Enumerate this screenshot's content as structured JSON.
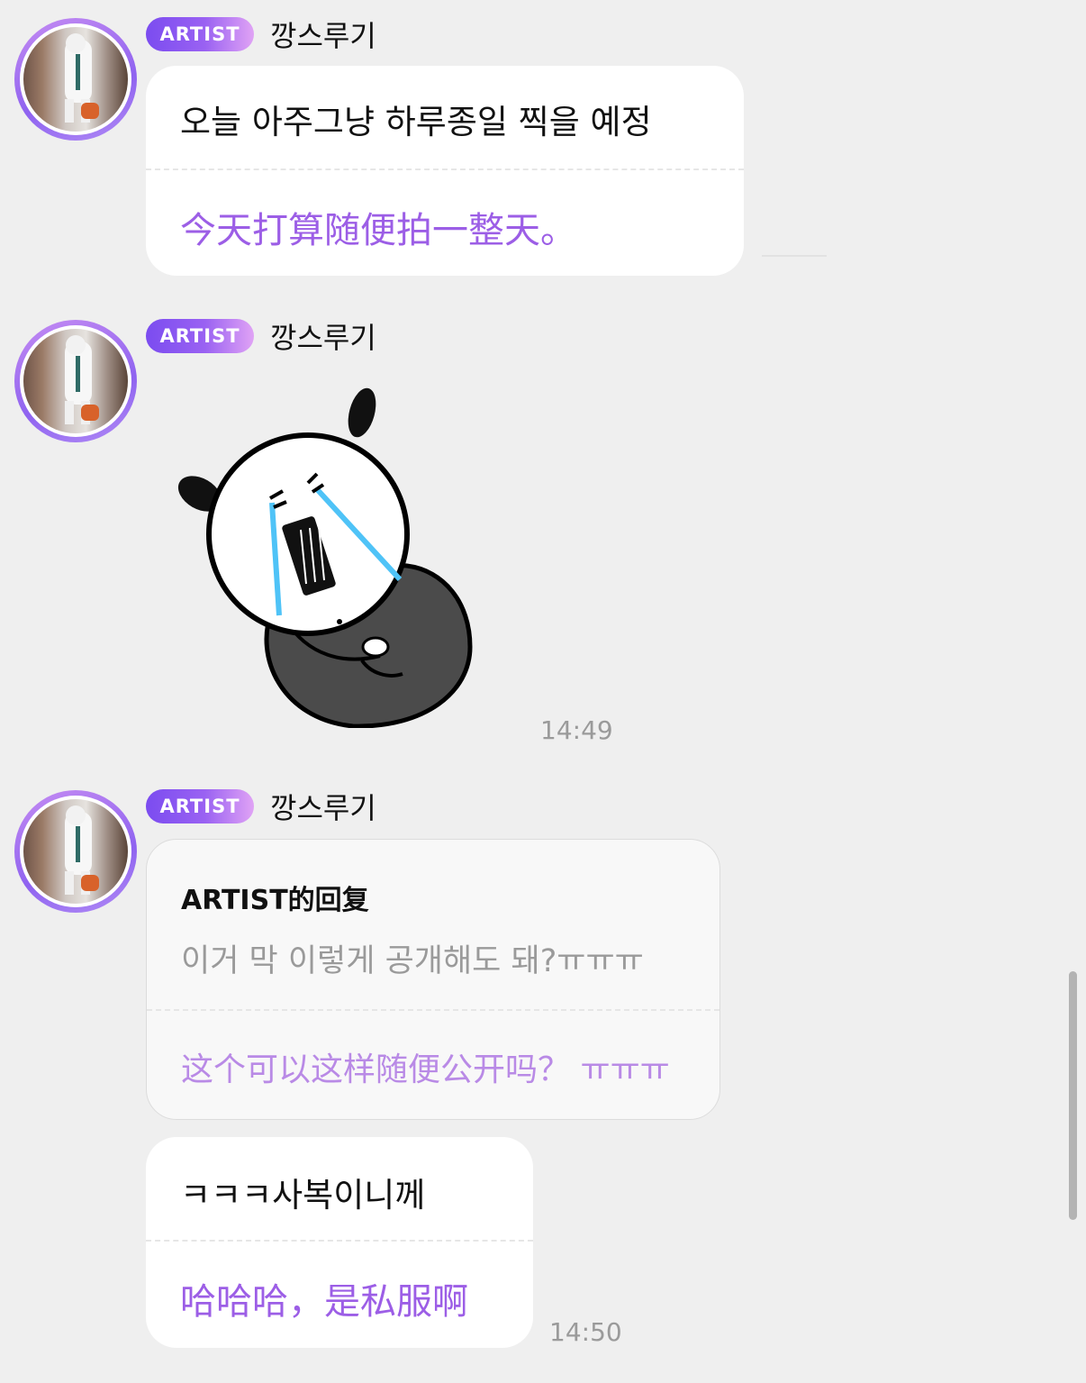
{
  "messages": [
    {
      "badge": "ARTIST",
      "sender": "깡스루기",
      "text_ko": "오늘 아주그냥 하루종일 찍을 예정",
      "text_zh": "今天打算随便拍一整天。"
    },
    {
      "badge": "ARTIST",
      "sender": "깡스루기",
      "sticker": "crying-bear-sticker",
      "time": "14:49"
    },
    {
      "badge": "ARTIST",
      "sender": "깡스루기",
      "reply": {
        "title": "ARTIST的回复",
        "text_ko": "이거 막 이렇게 공개해도 돼?ㅠㅠㅠ",
        "text_zh": "这个可以这样随便公开吗？ ㅠㅠㅠ"
      },
      "text_ko": "ㅋㅋㅋ사복이니께",
      "text_zh": "哈哈哈，是私服啊",
      "time": "14:50"
    }
  ],
  "colors": {
    "background": "#efefef",
    "translation": "#9c5ee6",
    "badge_gradient_start": "#7b4cf0",
    "badge_gradient_end": "#e0a3f5"
  }
}
